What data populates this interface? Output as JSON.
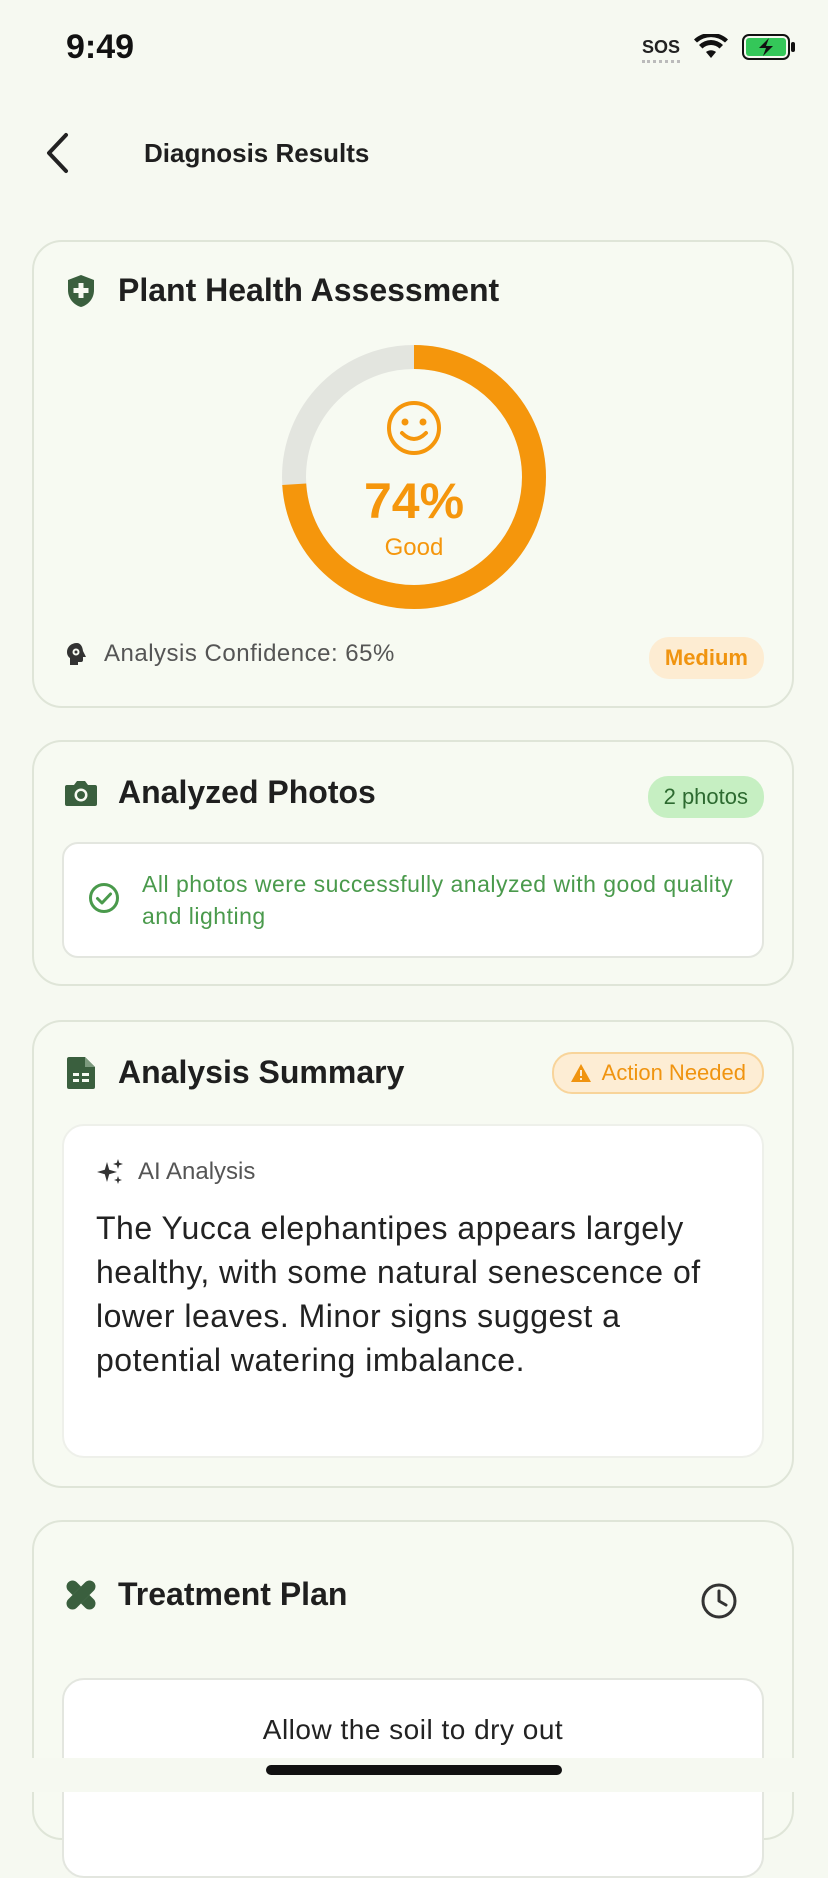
{
  "status_bar": {
    "time": "9:49",
    "sos": "SOS"
  },
  "nav": {
    "title": "Diagnosis Results"
  },
  "health": {
    "title": "Plant Health Assessment",
    "score_value": 74,
    "score_text": "74%",
    "status": "Good",
    "confidence_text": "Analysis Confidence: 65%",
    "confidence_level": "Medium"
  },
  "photos": {
    "title": "Analyzed Photos",
    "count_badge": "2 photos",
    "notice": "All photos were successfully analyzed with good quality and lighting"
  },
  "summary": {
    "title": "Analysis Summary",
    "badge": "Action Needed",
    "ai_label": "AI Analysis",
    "text": "The Yucca elephantipes appears largely healthy, with some natural senescence of lower leaves. Minor signs suggest a potential watering imbalance."
  },
  "treatment": {
    "title": "Treatment Plan",
    "first_step": "Allow the soil to dry out"
  },
  "colors": {
    "accent_orange": "#f5960c",
    "brand_green": "#3a5f3e",
    "success_green": "#4a9a4c",
    "background": "#f6f9f1"
  }
}
